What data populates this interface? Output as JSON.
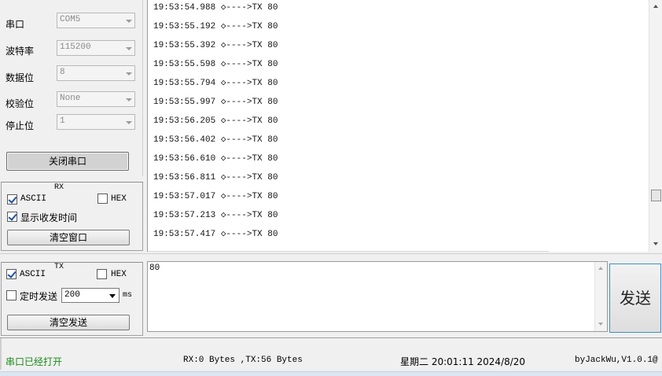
{
  "serial_config": {
    "port_label": "串口",
    "port_value": "COM5",
    "baud_label": "波特率",
    "baud_value": "115200",
    "data_bits_label": "数据位",
    "data_bits_value": "8",
    "parity_label": "校验位",
    "parity_value": "None",
    "stop_bits_label": "停止位",
    "stop_bits_value": "1",
    "close_port_label": "关闭串口"
  },
  "rx": {
    "group_title": "RX",
    "ascii_label": "ASCII",
    "ascii_checked": true,
    "hex_label": "HEX",
    "hex_checked": false,
    "show_time_label": "显示收发时间",
    "show_time_checked": true,
    "clear_label": "清空窗口"
  },
  "tx": {
    "group_title": "TX",
    "ascii_label": "ASCII",
    "ascii_checked": true,
    "hex_label": "HEX",
    "hex_checked": false,
    "timer_label": "定时发送",
    "timer_checked": false,
    "interval_value": "200",
    "interval_unit": "ms",
    "clear_label": "清空发送",
    "input_value": "80",
    "send_label": "发送"
  },
  "receive_log": [
    "19:53:54.988 ◇---->TX 80",
    "19:53:55.192 ◇---->TX 80",
    "19:53:55.392 ◇---->TX 80",
    "19:53:55.598 ◇---->TX 80",
    "19:53:55.794 ◇---->TX 80",
    "19:53:55.997 ◇---->TX 80",
    "19:53:56.205 ◇---->TX 80",
    "19:53:56.402 ◇---->TX 80",
    "19:53:56.610 ◇---->TX 80",
    "19:53:56.811 ◇---->TX 80",
    "19:53:57.017 ◇---->TX 80",
    "19:53:57.213 ◇---->TX 80",
    "19:53:57.417 ◇---->TX 80"
  ],
  "status": {
    "port_state": "串口已经打开",
    "port_state_color": "#1a8a1a",
    "counters": "RX:0 Bytes ,TX:56 Bytes",
    "datetime": "星期二 20:01:11 2024/8/20",
    "version": "byJackWu,V1.0.1@"
  },
  "icons": {
    "combo_arrow": "chevron-down-icon",
    "scroll_up": "arrow-up-icon",
    "scroll_down": "arrow-down-icon",
    "checkbox": "check-icon"
  }
}
